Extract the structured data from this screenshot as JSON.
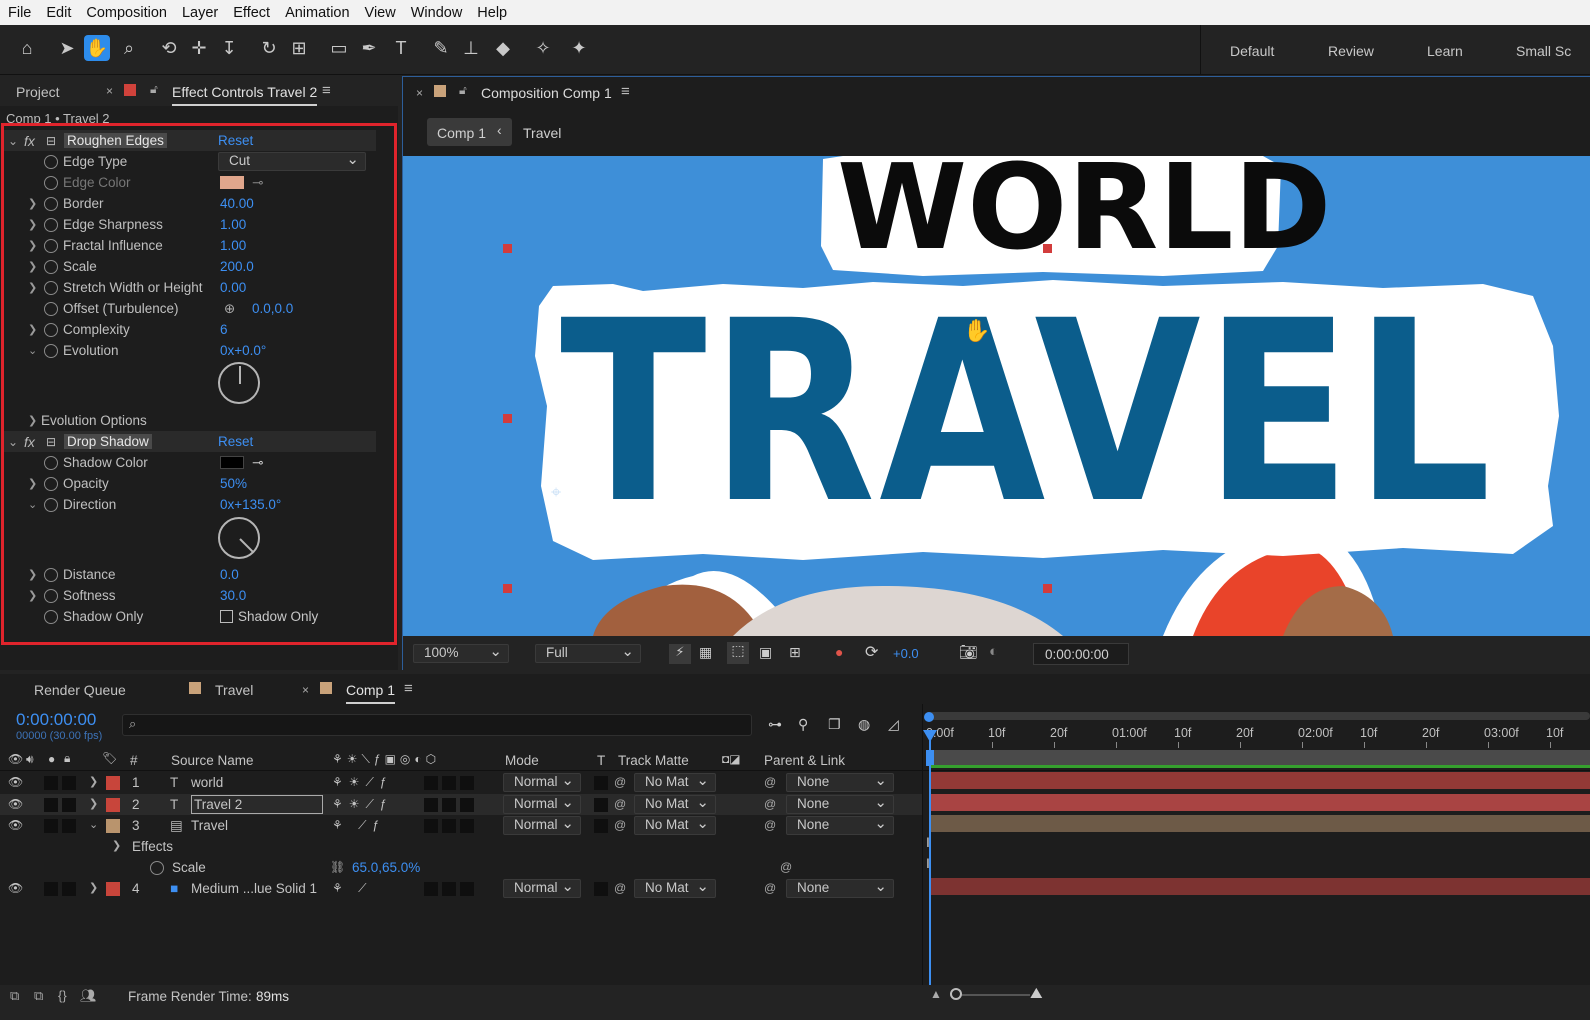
{
  "menu": [
    "File",
    "Edit",
    "Composition",
    "Layer",
    "Effect",
    "Animation",
    "View",
    "Window",
    "Help"
  ],
  "workspaces": [
    "Default",
    "Review",
    "Learn",
    "Small Sc"
  ],
  "left_panel": {
    "tab_project": "Project",
    "tab_effect_controls": "Effect Controls Travel 2",
    "breadcrumb": "Comp 1 • Travel 2"
  },
  "roughen": {
    "name": "Roughen Edges",
    "reset": "Reset",
    "rows": [
      {
        "label": "Edge Type",
        "value": "Cut"
      },
      {
        "label": "Edge Color",
        "value": ""
      },
      {
        "label": "Border",
        "value": "40.00"
      },
      {
        "label": "Edge Sharpness",
        "value": "1.00"
      },
      {
        "label": "Fractal Influence",
        "value": "1.00"
      },
      {
        "label": "Scale",
        "value": "200.0"
      },
      {
        "label": "Stretch Width or Height",
        "value": "0.00"
      },
      {
        "label": "Offset (Turbulence)",
        "value": "0.0,0.0"
      },
      {
        "label": "Complexity",
        "value": "6"
      },
      {
        "label": "Evolution",
        "value": "0x+0.0°"
      }
    ],
    "evolution_options": "Evolution Options",
    "edge_color": "#e0a68c"
  },
  "drop_shadow": {
    "name": "Drop Shadow",
    "reset": "Reset",
    "rows": [
      {
        "label": "Shadow Color",
        "value": ""
      },
      {
        "label": "Opacity",
        "value": "50%"
      },
      {
        "label": "Direction",
        "value": "0x+135.0°"
      },
      {
        "label": "Distance",
        "value": "0.0"
      },
      {
        "label": "Softness",
        "value": "30.0"
      },
      {
        "label": "Shadow Only",
        "value": "Shadow Only"
      }
    ],
    "shadow_color": "#000000"
  },
  "comp_panel": {
    "tab": "Composition Comp 1",
    "crumb_comp": "Comp 1",
    "crumb_layer": "Travel",
    "title_world": "WORLD",
    "title_travel": "TRAVEL",
    "zoom": "100%",
    "resolution": "Full",
    "exposure": "+0.0",
    "timecode": "0:00:00:00"
  },
  "timeline": {
    "tabs": [
      "Render Queue",
      "Travel",
      "Comp 1"
    ],
    "timecode": "0:00:00:00",
    "fps": "00000 (30.00 fps)",
    "columns": {
      "source": "Source Name",
      "mode": "Mode",
      "t": "T",
      "track": "Track Matte",
      "parent": "Parent & Link"
    },
    "ruler": [
      "0:00f",
      "10f",
      "20f",
      "01:00f",
      "10f",
      "20f",
      "02:00f",
      "10f",
      "20f",
      "03:00f",
      "10f"
    ],
    "layers": [
      {
        "num": "1",
        "name": "world",
        "mode": "Normal",
        "track": "No Mat",
        "parent": "None",
        "color": "#c8453b"
      },
      {
        "num": "2",
        "name": "Travel 2",
        "mode": "Normal",
        "track": "No Mat",
        "parent": "None",
        "color": "#c8453b"
      },
      {
        "num": "3",
        "name": "Travel",
        "mode": "Normal",
        "track": "No Mat",
        "parent": "None",
        "color": "#b9946d"
      },
      {
        "num": "4",
        "name": "Medium ...lue Solid 1",
        "mode": "Normal",
        "track": "No Mat",
        "parent": "None",
        "color": "#c8453b"
      }
    ],
    "effects_label": "Effects",
    "scale_label": "Scale",
    "scale_value": "65.0,65.0%",
    "footer_label": "Frame Render Time:",
    "footer_value": "89ms"
  },
  "colors": {
    "accent": "#2d8ceb",
    "comp_bg": "#3e8fd8",
    "travel_text": "#0b5d8c",
    "highlight": "#e0242c"
  }
}
